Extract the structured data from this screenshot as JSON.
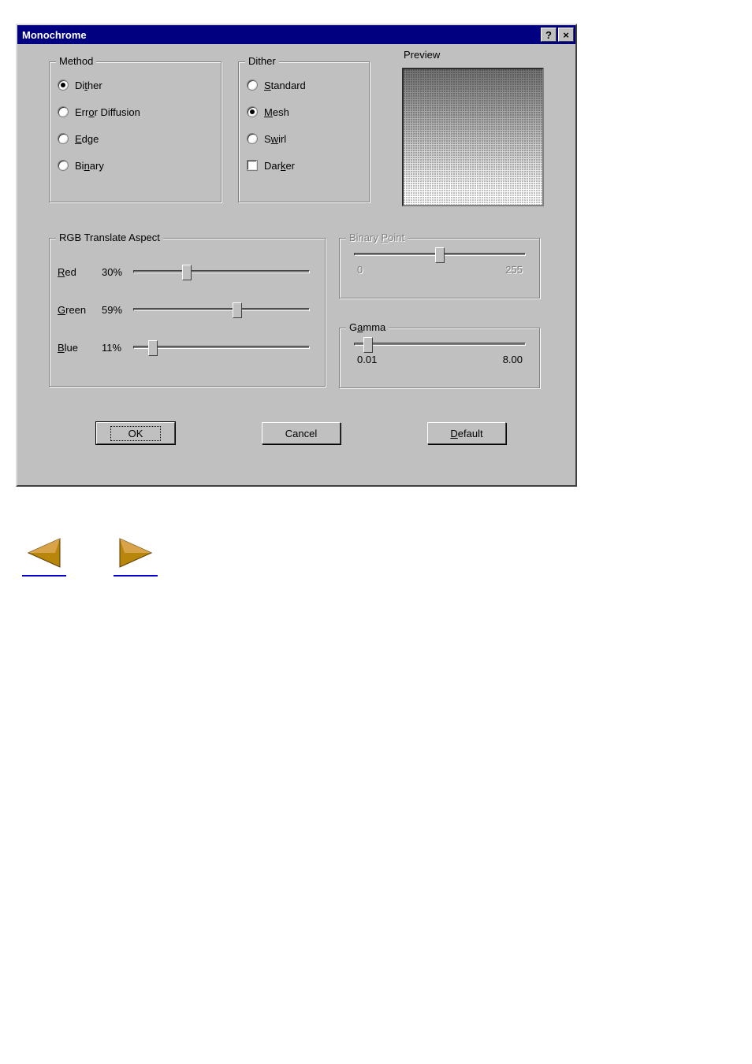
{
  "title": "Monochrome",
  "method": {
    "legend": "Method",
    "options": [
      {
        "label": "Dither",
        "accel": "t",
        "checked": true
      },
      {
        "label": "Error Diffusion",
        "accel": "o",
        "checked": false
      },
      {
        "label": "Edge",
        "accel": "E",
        "checked": false
      },
      {
        "label": "Binary",
        "accel": "n",
        "checked": false
      }
    ]
  },
  "dither": {
    "legend": "Dither",
    "options": [
      {
        "label": "Standard",
        "accel": "S",
        "checked": false
      },
      {
        "label": "Mesh",
        "accel": "M",
        "checked": true
      },
      {
        "label": "Swirl",
        "accel": "w",
        "checked": false
      }
    ],
    "darker": {
      "label": "Darker",
      "accel": "k",
      "checked": false
    }
  },
  "preview_label": "Preview",
  "rgb": {
    "legend": "RGB Translate Aspect",
    "rows": [
      {
        "label": "Red",
        "accel": "R",
        "pct": "30%",
        "pos": 30
      },
      {
        "label": "Green",
        "accel": "G",
        "pct": "59%",
        "pos": 59
      },
      {
        "label": "Blue",
        "accel": "B",
        "pct": "11%",
        "pos": 11
      }
    ]
  },
  "binary_point": {
    "legend": "Binary Point",
    "accel": "P",
    "min": "0",
    "max": "255",
    "pos": 50,
    "disabled": true
  },
  "gamma": {
    "legend": "Gamma",
    "accel": "a",
    "min": "0.01",
    "max": "8.00",
    "pos": 8
  },
  "buttons": {
    "ok": "OK",
    "cancel": "Cancel",
    "default": "Default",
    "default_accel": "D"
  }
}
